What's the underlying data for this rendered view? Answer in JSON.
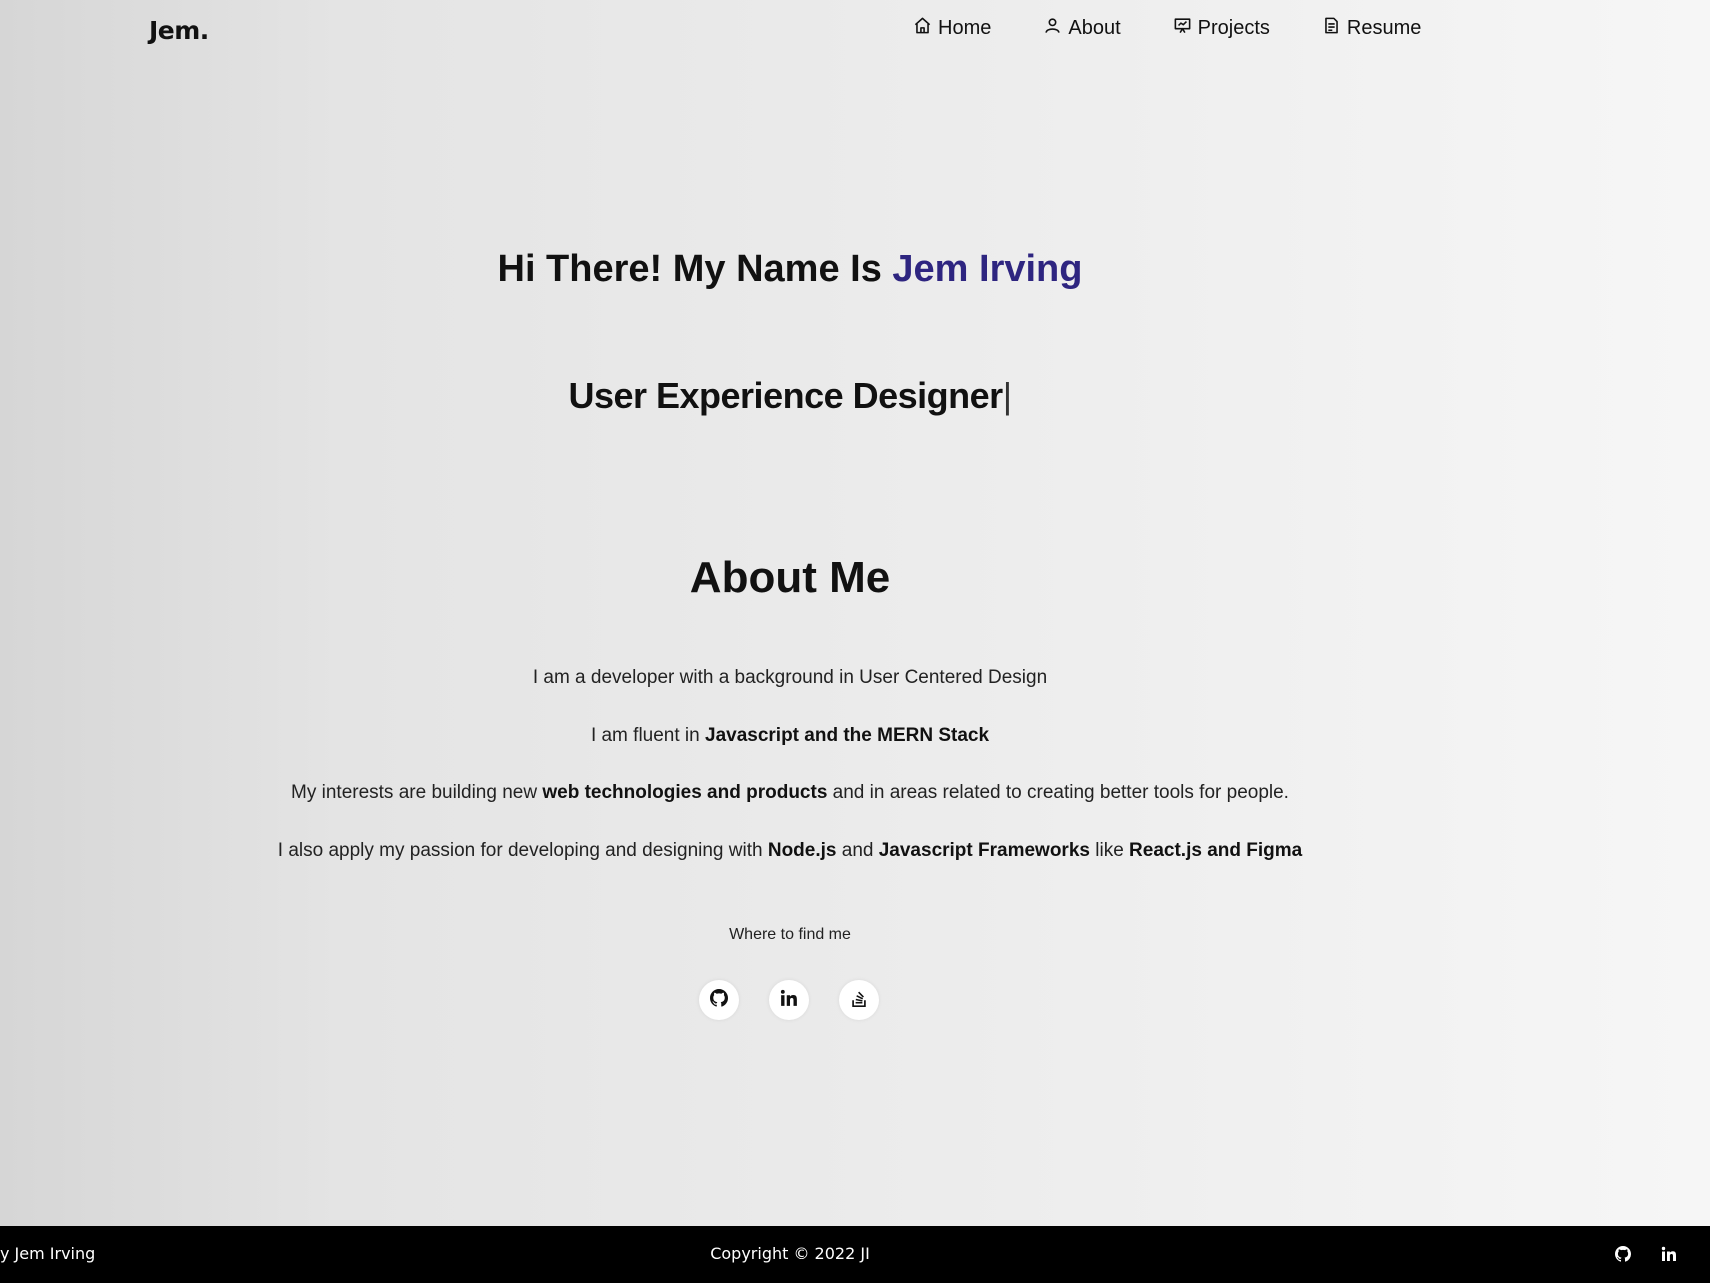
{
  "brand": "Jem.",
  "nav": [
    {
      "label": "Home",
      "icon": "home-icon"
    },
    {
      "label": "About",
      "icon": "user-icon"
    },
    {
      "label": "Projects",
      "icon": "presentation-icon"
    },
    {
      "label": "Resume",
      "icon": "document-icon"
    }
  ],
  "hero": {
    "greeting": "Hi There! My Name Is ",
    "name": "Jem Irving",
    "role": "User Experience Designer",
    "cursor": "|",
    "name_color": "#2e2580"
  },
  "about": {
    "title": "About Me",
    "line1": "I am a developer with a background in User Centered Design",
    "line2_a": "I am fluent in ",
    "line2_b": "Javascript and the MERN Stack",
    "line3_a": "My interests are building new ",
    "line3_b": "web technologies and products",
    "line3_c": " and in areas related to creating better tools for people.",
    "line4_a": "I also apply my passion for developing and designing with ",
    "line4_b": "Node.js",
    "line4_c": " and ",
    "line4_d": "Javascript Frameworks",
    "line4_e": " like ",
    "line4_f": "React.js and Figma"
  },
  "social": {
    "heading": "Where to find me",
    "links": [
      "github-icon",
      "linkedin-icon",
      "stackoverflow-icon"
    ]
  },
  "footer": {
    "left": "y Jem Irving",
    "center": "Copyright © 2022 JI",
    "icons": [
      "github-icon",
      "linkedin-icon"
    ]
  }
}
